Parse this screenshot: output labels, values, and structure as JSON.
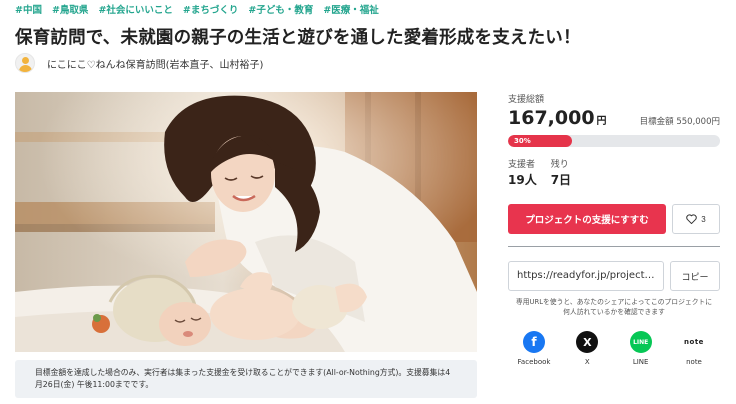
{
  "tags": [
    "#中国",
    "#鳥取県",
    "#社会にいいこと",
    "#まちづくり",
    "#子ども・教育",
    "#医療・福祉"
  ],
  "project": {
    "title": "保育訪問で、未就園の親子の生活と遊びを通した愛着形成を支えたい！",
    "owner": "にこにこ♡ねんね保育訪問(岩本直子、山村裕子)"
  },
  "notice": "目標金額を達成した場合のみ、実行者は集まった支援金を受け取ることができます(All-or-Nothing方式)。支援募集は4月26日(金) 午後11:00までです。",
  "funding": {
    "raised_label": "支援総額",
    "raised": "167,000",
    "unit": "円",
    "goal_label": "目標金額",
    "goal": "550,000円",
    "progress_text": "30%",
    "progress_fraction": 0.3,
    "supporters_label": "支援者",
    "supporters": "19人",
    "remaining_label": "残り",
    "remaining": "7日"
  },
  "actions": {
    "cta": "プロジェクトの支援にすすむ",
    "favorite_count": "3"
  },
  "share": {
    "url": "https://readyfor.jp/projects/nikoniko",
    "copy": "コピー",
    "help": "専用URLを使うと、あなたのシェアによってこのプロジェクトに何人訪れているかを確認できます",
    "buttons": [
      {
        "label": "Facebook",
        "glyph": "f"
      },
      {
        "label": "X",
        "glyph": "X"
      },
      {
        "label": "LINE",
        "glyph": "LINE"
      },
      {
        "label": "note",
        "glyph": "note"
      }
    ]
  },
  "colors": {
    "accent": "#e8344e",
    "tag": "#23a58e",
    "facebook": "#1877f2",
    "line": "#06c755"
  }
}
